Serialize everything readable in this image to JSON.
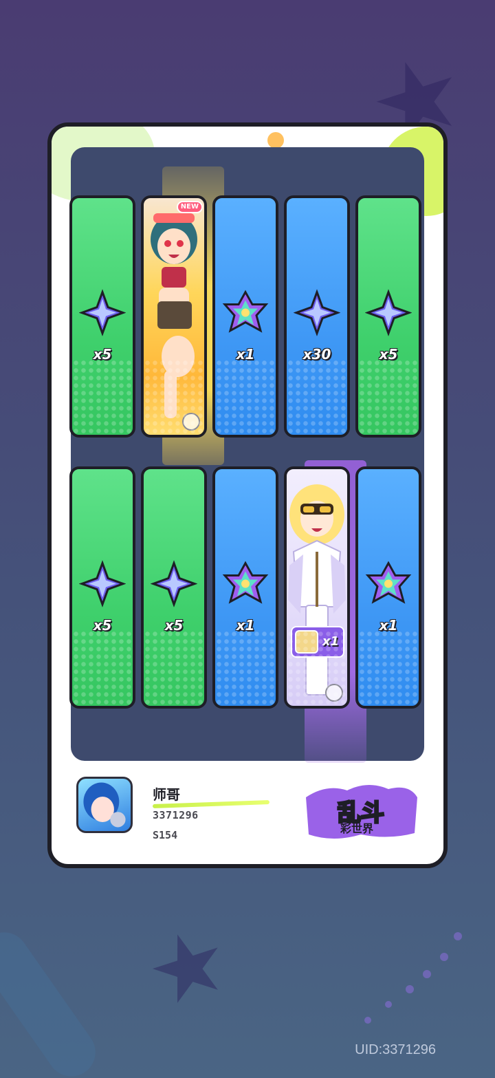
{
  "colors": {
    "green_tile": "#3fd06c",
    "blue_tile": "#3f98f5",
    "panel": "#3e4a6d",
    "gold_beam": "#ffe15a",
    "purple_beam": "#aa6ef0"
  },
  "rewards": [
    {
      "row": 1,
      "kind": "item",
      "icon": "star-crystal-icon",
      "qty": "x5",
      "color": "green"
    },
    {
      "row": 1,
      "kind": "character",
      "icon": "character-portrait-girl",
      "badge": "NEW",
      "color": "gold"
    },
    {
      "row": 1,
      "kind": "item",
      "icon": "rainbow-gem-icon",
      "qty": "x1",
      "color": "blue"
    },
    {
      "row": 1,
      "kind": "item",
      "icon": "star-crystal-icon",
      "qty": "x30",
      "color": "blue"
    },
    {
      "row": 1,
      "kind": "item",
      "icon": "star-crystal-icon",
      "qty": "x5",
      "color": "green"
    },
    {
      "row": 2,
      "kind": "item",
      "icon": "star-crystal-icon",
      "qty": "x5",
      "color": "green"
    },
    {
      "row": 2,
      "kind": "item",
      "icon": "star-crystal-icon",
      "qty": "x5",
      "color": "green"
    },
    {
      "row": 2,
      "kind": "item",
      "icon": "rainbow-gem-icon",
      "qty": "x1",
      "color": "blue"
    },
    {
      "row": 2,
      "kind": "character",
      "icon": "character-portrait-blonde",
      "qty": "x1",
      "color": "purple"
    },
    {
      "row": 2,
      "kind": "item",
      "icon": "rainbow-gem-icon",
      "qty": "x1",
      "color": "blue"
    }
  ],
  "player": {
    "name": "师哥",
    "id": "3371296",
    "server": "S154"
  },
  "logo": {
    "title": "乱斗",
    "subtitle": "彩世界"
  },
  "uid_text": "UID:3371296"
}
